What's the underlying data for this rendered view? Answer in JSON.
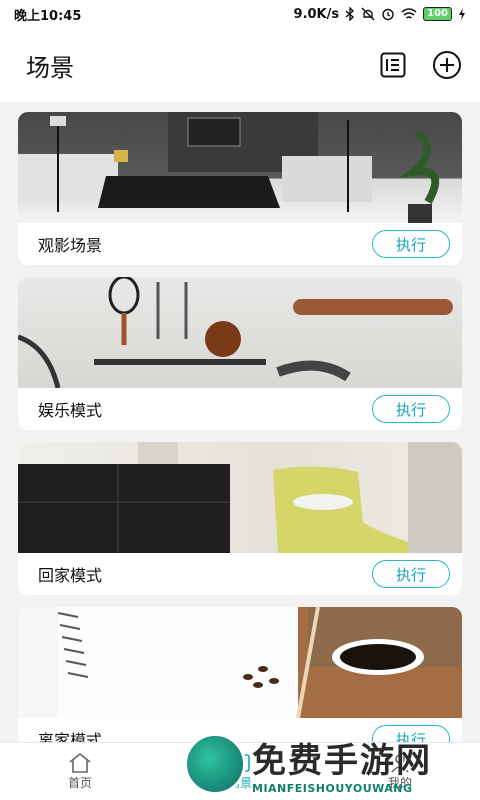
{
  "status": {
    "time": "晚上10:45",
    "network": "9.0K/s",
    "battery": "100"
  },
  "header": {
    "title": "场景",
    "list_icon": "list-icon",
    "add_icon": "plus-circle-icon"
  },
  "scenes": [
    {
      "name": "观影场景",
      "action": "执行",
      "image": "living-room-photo"
    },
    {
      "name": "娱乐模式",
      "action": "执行",
      "image": "sports-wall-photo"
    },
    {
      "name": "回家模式",
      "action": "执行",
      "image": "bedroom-chaise-photo"
    },
    {
      "name": "离家模式",
      "action": "执行",
      "image": "notebook-coffee-photo"
    }
  ],
  "nav": [
    {
      "label": "首页",
      "icon": "home-icon"
    },
    {
      "label": "场景",
      "icon": "scene-icon"
    },
    {
      "label": "我的",
      "icon": "user-icon"
    }
  ],
  "watermark": {
    "cn": "免费手游网",
    "en": "MIANFEISHOUYOUWANG"
  },
  "colors": {
    "accent": "#14a7b8",
    "background": "#f2f2f2"
  }
}
